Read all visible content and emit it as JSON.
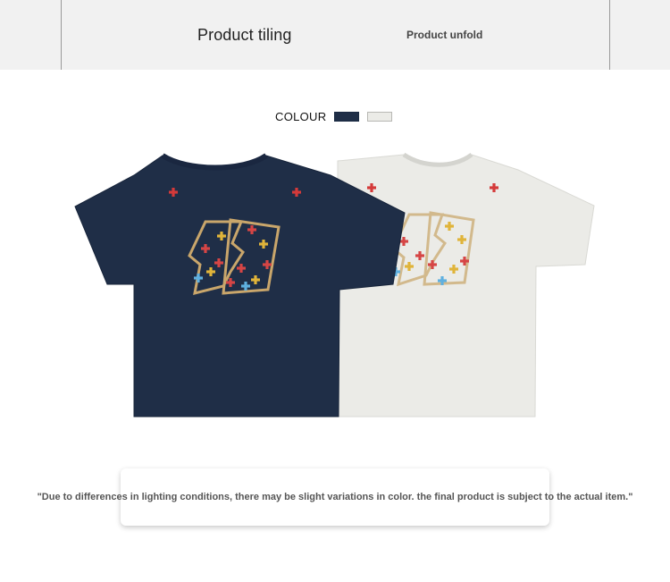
{
  "header": {
    "tab_tiling": "Product tiling",
    "tab_unfold": "Product unfold"
  },
  "colour_selector": {
    "label": "COLOUR",
    "swatches": [
      {
        "name": "navy",
        "color": "#1f2e47"
      },
      {
        "name": "light-grey",
        "color": "#ebebe7"
      }
    ]
  },
  "products": [
    {
      "name": "navy-tshirt",
      "color": "#1f2e47",
      "graphic_icon": "cross-pattern-letters-icon"
    },
    {
      "name": "grey-tshirt",
      "color": "#ebebe7",
      "graphic_icon": "cross-pattern-letters-icon"
    }
  ],
  "disclaimer": "\"Due to differences in lighting conditions, there may be slight variations in color. the final product is subject to the actual item.\""
}
